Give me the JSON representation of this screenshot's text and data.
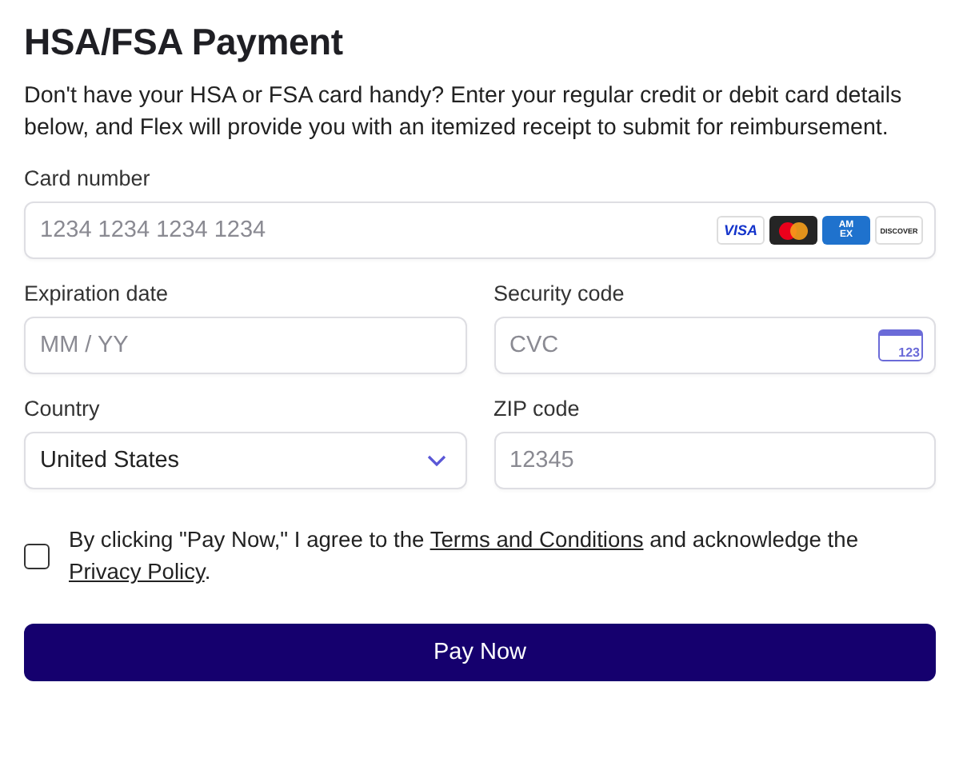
{
  "title": "HSA/FSA Payment",
  "description": "Don't have your HSA or FSA card handy? Enter your regular credit or debit card details below, and Flex will provide you with an itemized receipt to submit for reimbursement.",
  "card_number": {
    "label": "Card number",
    "placeholder": "1234 1234 1234 1234",
    "brands": [
      {
        "kind": "visa",
        "label": "VISA"
      },
      {
        "kind": "mastercard"
      },
      {
        "kind": "amex",
        "label": "AM EX"
      },
      {
        "kind": "discover",
        "label": "DISCOVER"
      }
    ]
  },
  "expiration": {
    "label": "Expiration date",
    "placeholder": "MM / YY"
  },
  "security_code": {
    "label": "Security code",
    "placeholder": "CVC",
    "icon_text": "123"
  },
  "country": {
    "label": "Country",
    "value": "United States"
  },
  "zip": {
    "label": "ZIP code",
    "placeholder": "12345"
  },
  "consent": {
    "checked": false,
    "before": "By clicking \"Pay Now,\" I agree to the ",
    "terms_link": "Terms and Conditions",
    "middle": " and acknowledge the ",
    "privacy_link": "Privacy Policy",
    "after": "."
  },
  "submit": "Pay Now"
}
